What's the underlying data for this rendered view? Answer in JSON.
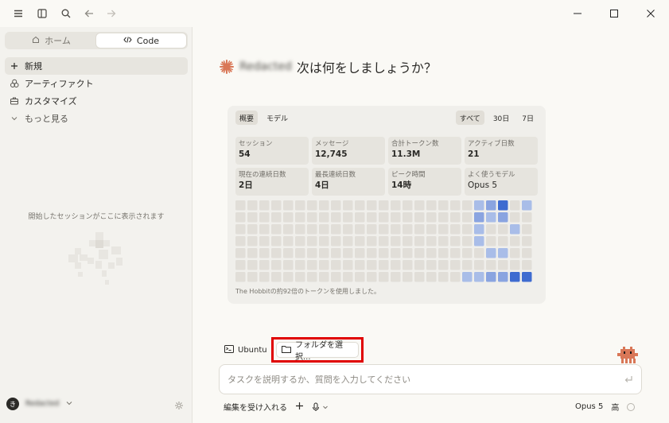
{
  "sidebar": {
    "segments": [
      {
        "label": "ホーム",
        "icon": "home-icon",
        "active": false
      },
      {
        "label": "Code",
        "icon": "code-icon",
        "active": true
      }
    ],
    "nav_items": [
      {
        "label": "新規",
        "icon": "plus-icon",
        "selected": true
      },
      {
        "label": "アーティファクト",
        "icon": "artifact-icon",
        "selected": false
      },
      {
        "label": "カスタマイズ",
        "icon": "briefcase-icon",
        "selected": false
      },
      {
        "label": "もっと見る",
        "icon": "chevron-down-icon",
        "selected": false
      }
    ],
    "empty_text": "開始したセッションがここに表示されます",
    "user": {
      "initial": "き",
      "name": "Redacted"
    }
  },
  "main": {
    "greeting": {
      "name": "Redacted",
      "text": "次は何をしましょうか？"
    },
    "stats_card": {
      "tabs_left": [
        {
          "label": "概要",
          "active": true
        },
        {
          "label": "モデル",
          "active": false
        }
      ],
      "tabs_right": [
        {
          "label": "すべて",
          "active": true
        },
        {
          "label": "30日",
          "active": false
        },
        {
          "label": "7日",
          "active": false
        }
      ],
      "stats": [
        {
          "label": "セッション",
          "value": "54"
        },
        {
          "label": "メッセージ",
          "value": "12,745"
        },
        {
          "label": "合計トークン数",
          "value": "11.3M"
        },
        {
          "label": "アクティブ日数",
          "value": "21"
        },
        {
          "label": "現在の連続日数",
          "value": "2日"
        },
        {
          "label": "最長連続日数",
          "value": "4日"
        },
        {
          "label": "ピーク時間",
          "value": "14時"
        },
        {
          "label": "よく使うモデル",
          "value": "Opus 5"
        }
      ],
      "footnote": "The Hobbitの約92倍のトークンを使用しました。",
      "heatmap": {
        "rows": 7,
        "cols": 25,
        "levels": [
          [
            0,
            0,
            0,
            0,
            0,
            0,
            0,
            0,
            0,
            0,
            0,
            0,
            0,
            0,
            0,
            0,
            0,
            0,
            0,
            0,
            1,
            2,
            3,
            0,
            1
          ],
          [
            0,
            0,
            0,
            0,
            0,
            0,
            0,
            0,
            0,
            0,
            0,
            0,
            0,
            0,
            0,
            0,
            0,
            0,
            0,
            0,
            2,
            1,
            2,
            0,
            0
          ],
          [
            0,
            0,
            0,
            0,
            0,
            0,
            0,
            0,
            0,
            0,
            0,
            0,
            0,
            0,
            0,
            0,
            0,
            0,
            0,
            0,
            1,
            0,
            0,
            1,
            0
          ],
          [
            0,
            0,
            0,
            0,
            0,
            0,
            0,
            0,
            0,
            0,
            0,
            0,
            0,
            0,
            0,
            0,
            0,
            0,
            0,
            0,
            1,
            0,
            0,
            0,
            0
          ],
          [
            0,
            0,
            0,
            0,
            0,
            0,
            0,
            0,
            0,
            0,
            0,
            0,
            0,
            0,
            0,
            0,
            0,
            0,
            0,
            0,
            0,
            1,
            1,
            0,
            0
          ],
          [
            0,
            0,
            0,
            0,
            0,
            0,
            0,
            0,
            0,
            0,
            0,
            0,
            0,
            0,
            0,
            0,
            0,
            0,
            0,
            0,
            0,
            0,
            0,
            0,
            0
          ],
          [
            0,
            0,
            0,
            0,
            0,
            0,
            0,
            0,
            0,
            0,
            0,
            0,
            0,
            0,
            0,
            0,
            0,
            0,
            0,
            1,
            1,
            2,
            2,
            3,
            3
          ]
        ],
        "colors": [
          "#e1ded8",
          "#a9bde8",
          "#8aa4e0",
          "#3e6bd0"
        ]
      }
    },
    "env_chip": {
      "label": "Ubuntu",
      "icon": "terminal-icon"
    },
    "folder_chip": {
      "label": "フォルダを選択...",
      "icon": "folder-icon"
    },
    "composer": {
      "placeholder": "タスクを説明するか、質問を入力してください"
    },
    "bottom": {
      "accept_edits": "編集を受け入れる",
      "model": "Opus 5",
      "effort": "高"
    }
  }
}
